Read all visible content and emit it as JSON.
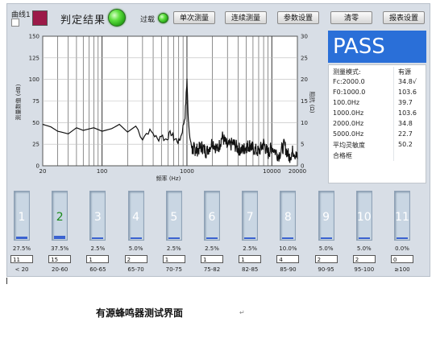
{
  "toolbar": {
    "curve_label": "曲线1",
    "judge_label": "判定结果",
    "overload_label": "过载",
    "buttons": [
      "单次测量",
      "连续测量",
      "参数设置",
      "清零",
      "报表设置"
    ]
  },
  "result": {
    "text": "PASS"
  },
  "colors": {
    "pass_bg": "#2a6fd8",
    "led_green": "#3ccf2a",
    "curve_swatch": "#9c1a48",
    "level_bar": "#3a62d0"
  },
  "measurements": [
    {
      "label": "测量模式:",
      "value": "有源"
    },
    {
      "label": "Fc:2000.0",
      "value": "34.8√"
    },
    {
      "label": "F0:1000.0",
      "value": "103.6"
    },
    {
      "label": "100.0Hz",
      "value": "39.7"
    },
    {
      "label": "1000.0Hz",
      "value": "103.6"
    },
    {
      "label": "2000.0Hz",
      "value": "34.8"
    },
    {
      "label": "5000.0Hz",
      "value": "22.7"
    },
    {
      "label": "平均灵敏度",
      "value": "50.2"
    },
    {
      "label": "合格框",
      "value": ""
    }
  ],
  "chart_data": {
    "type": "line",
    "xlabel": "频率 (Hz)",
    "ylabel": "测量数值 (dB)",
    "y2label": "阻抗 (Ω)",
    "x_scale": "log",
    "xlim": [
      20,
      20000
    ],
    "ylim": [
      0,
      150
    ],
    "y2lim": [
      0,
      30
    ],
    "x_ticks": [
      "20",
      "100",
      "1000",
      "10000",
      "20000"
    ],
    "y_ticks": [
      "0",
      "25",
      "50",
      "75",
      "100",
      "125",
      "150"
    ],
    "y2_ticks": [
      "0",
      "5",
      "10",
      "15",
      "20",
      "25",
      "30"
    ],
    "grid": true,
    "series": [
      {
        "x": [
          20,
          25,
          30,
          40,
          50,
          60,
          80,
          100,
          130,
          160,
          200,
          250,
          300,
          350,
          400,
          450,
          500,
          550,
          600,
          650,
          700,
          750,
          800,
          850,
          900,
          950,
          980,
          1000,
          1020,
          1050,
          1100,
          1150,
          1200,
          1300,
          1500,
          1700,
          2000,
          2300,
          2600,
          3000,
          3500,
          4000,
          4500,
          5000,
          5500,
          6000,
          7000,
          8000,
          9000,
          10000,
          12000,
          14000,
          16000,
          18000,
          20000
        ],
        "y": [
          48,
          45,
          40,
          37,
          44,
          41,
          44,
          40,
          43,
          48,
          39,
          46,
          32,
          40,
          38,
          30,
          36,
          30,
          34,
          38,
          32,
          30,
          28,
          34,
          45,
          58,
          82,
          100,
          72,
          48,
          30,
          16,
          20,
          18,
          22,
          16,
          28,
          18,
          34,
          22,
          26,
          20,
          18,
          22,
          24,
          20,
          16,
          26,
          14,
          22,
          12,
          24,
          10,
          18,
          8
        ]
      }
    ]
  },
  "bins": [
    {
      "num": "1",
      "pct": "27.5%",
      "count": "11",
      "range": "< 20",
      "level": 0.275
    },
    {
      "num": "2",
      "pct": "37.5%",
      "count": "15",
      "range": "20-60",
      "level": 0.375
    },
    {
      "num": "3",
      "pct": "2.5%",
      "count": "1",
      "range": "60-65",
      "level": 0.025
    },
    {
      "num": "4",
      "pct": "5.0%",
      "count": "2",
      "range": "65-70",
      "level": 0.05
    },
    {
      "num": "5",
      "pct": "2.5%",
      "count": "1",
      "range": "70-75",
      "level": 0.025
    },
    {
      "num": "6",
      "pct": "2.5%",
      "count": "1",
      "range": "75-82",
      "level": 0.025
    },
    {
      "num": "7",
      "pct": "2.5%",
      "count": "1",
      "range": "82-85",
      "level": 0.025
    },
    {
      "num": "8",
      "pct": "10.0%",
      "count": "4",
      "range": "85-90",
      "level": 0.1
    },
    {
      "num": "9",
      "pct": "5.0%",
      "count": "2",
      "range": "90-95",
      "level": 0.05
    },
    {
      "num": "10",
      "pct": "5.0%",
      "count": "2",
      "range": "95-100",
      "level": 0.05
    },
    {
      "num": "11",
      "pct": "0.0%",
      "count": "0",
      "range": "≥100",
      "level": 0.0
    }
  ],
  "caption": "有源蜂鸣器测试界面",
  "caption_mark": "↵"
}
